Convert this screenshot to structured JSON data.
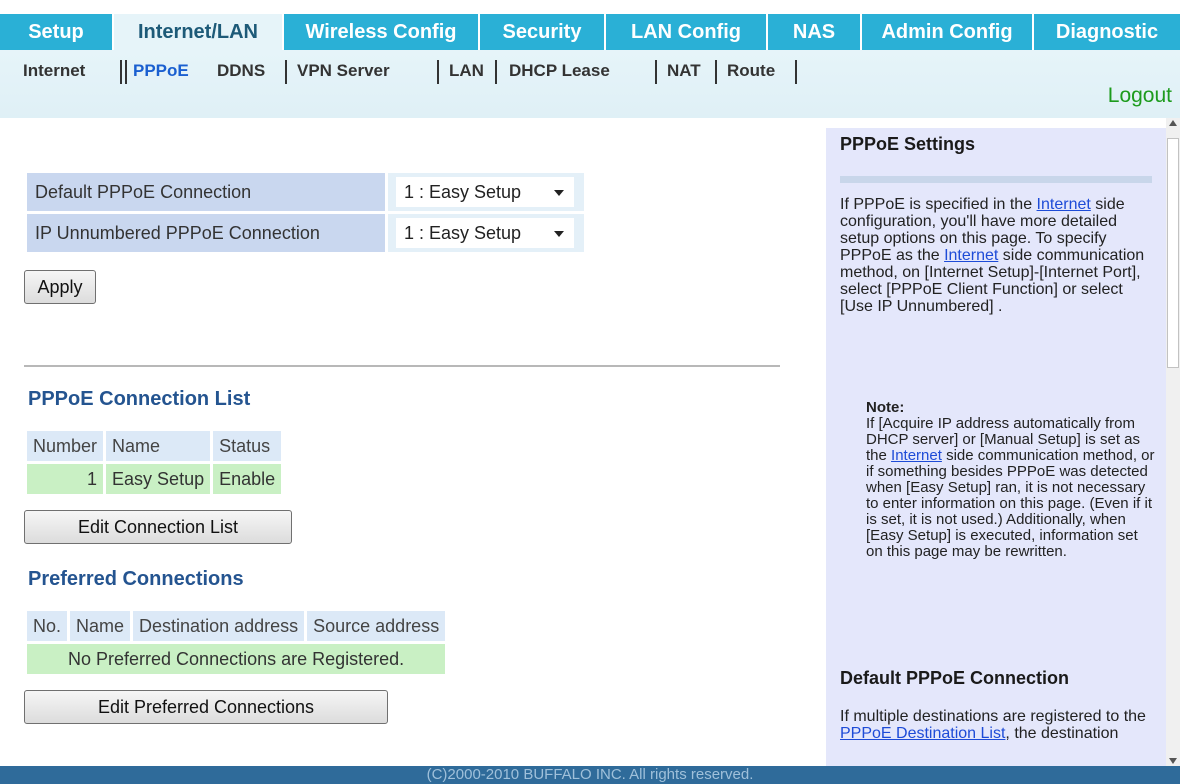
{
  "nav": {
    "tabs": [
      "Setup",
      "Internet/LAN",
      "Wireless Config",
      "Security",
      "LAN Config",
      "NAS",
      "Admin Config",
      "Diagnostic"
    ],
    "sub": [
      "Internet",
      "PPPoE",
      "DDNS",
      "VPN Server",
      "LAN",
      "DHCP Lease",
      "NAT",
      "Route"
    ],
    "logout": "Logout"
  },
  "form": {
    "default_label": "Default PPPoE Connection",
    "default_value": "1 : Easy Setup",
    "unnumbered_label": "IP Unnumbered PPPoE Connection",
    "unnumbered_value": "1 : Easy Setup",
    "apply": "Apply"
  },
  "conn_list": {
    "title": "PPPoE Connection List",
    "headers": [
      "Number",
      "Name",
      "Status"
    ],
    "row": [
      "1",
      "Easy Setup",
      "Enable"
    ],
    "edit": "Edit Connection List"
  },
  "preferred": {
    "title": "Preferred Connections",
    "headers": [
      "No.",
      "Name",
      "Destination address",
      "Source address"
    ],
    "empty": "No Preferred Connections are Registered.",
    "edit": "Edit Preferred Connections"
  },
  "help": {
    "title": "PPPoE Settings",
    "p1a": "If PPPoE is specified in the ",
    "link1": "Internet",
    "p1b": " side configuration, you'll have more detailed setup options on this page. To specify PPPoE as the ",
    "link2": "Internet",
    "p1c": " side communication method, on [Internet Setup]-[Internet Port], select [PPPoE Client Function] or select [Use IP Unnumbered] .",
    "note_title": "Note:",
    "note_a": "If [Acquire IP address automatically from DHCP server] or [Manual Setup] is set as the ",
    "note_link": "Internet",
    "note_b": " side communication method, or if something besides PPPoE was detected when [Easy Setup] ran, it is not necessary to enter information on this page. (Even if it is set, it is not used.) Additionally, when [Easy Setup] is executed, information set on this page may be rewritten.",
    "title2": "Default PPPoE Connection",
    "p2a": "If multiple destinations are registered to the ",
    "p2link": "PPPoE Destination List",
    "p2b": ", the destination"
  },
  "footer": "(C)2000-2010 BUFFALO INC. All rights reserved."
}
